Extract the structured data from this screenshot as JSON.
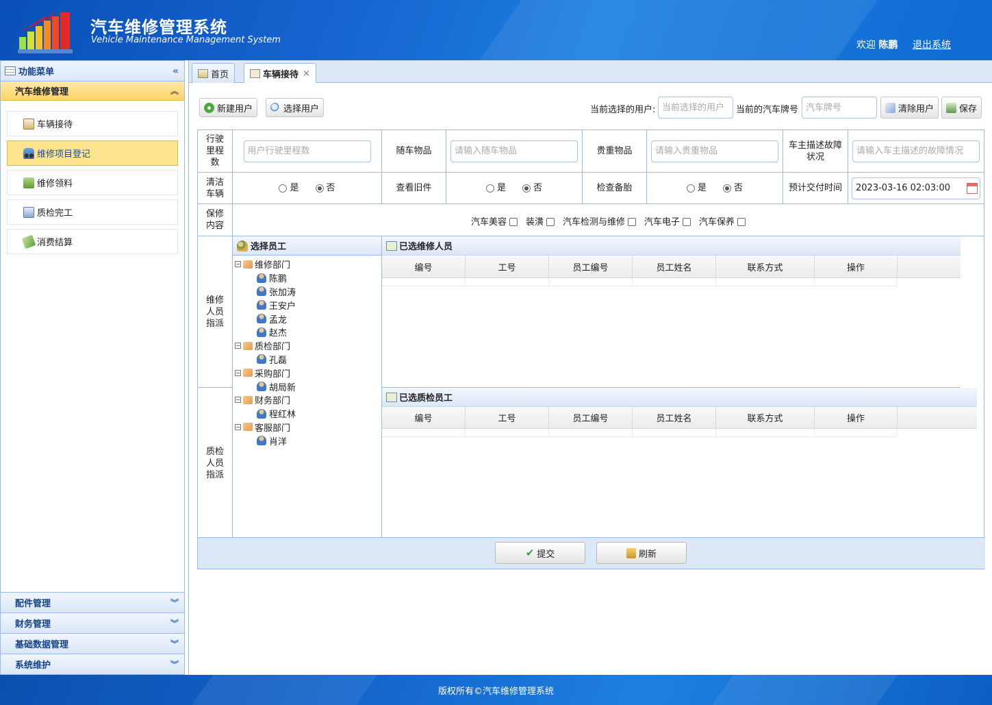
{
  "header": {
    "title_cn": "汽车维修管理系统",
    "title_en": "Vehicle Maintenance Management System",
    "welcome_prefix": "欢迎",
    "user_name": "陈鹏",
    "logout": "退出系统"
  },
  "sidebar": {
    "title": "功能菜单",
    "open_group": "汽车维修管理",
    "items": [
      {
        "label": "车辆接待",
        "icon": "reception-icon"
      },
      {
        "label": "维修项目登记",
        "icon": "car-icon",
        "active": true
      },
      {
        "label": "维修领料",
        "icon": "cart-icon"
      },
      {
        "label": "质检完工",
        "icon": "quality-icon"
      },
      {
        "label": "消费结算",
        "icon": "money-icon"
      }
    ],
    "collapsed_groups": [
      "配件管理",
      "财务管理",
      "基础数据管理",
      "系统维护"
    ]
  },
  "tabs": [
    {
      "label": "首页"
    },
    {
      "label": "车辆接待",
      "selected": true
    }
  ],
  "toolbar": {
    "new_user": "新建用户",
    "select_user": "选择用户",
    "current_user_label": "当前选择的用户:",
    "current_user_placeholder": "当前选择的用户",
    "plate_label": "当前的汽车牌号",
    "plate_placeholder": "汽车牌号",
    "clear_user": "清除用户",
    "save": "保存"
  },
  "form": {
    "mileage_label": "行驶里程数",
    "mileage_placeholder": "用户行驶里程数",
    "items_label": "随车物品",
    "items_placeholder": "请输入随车物品",
    "valuables_label": "贵重物品",
    "valuables_placeholder": "请输入贵重物品",
    "fault_label": "车主描述故障状况",
    "fault_placeholder": "请输入车主描述的故障情况",
    "clean_label": "清洁车辆",
    "old_parts_label": "查看旧件",
    "spare_tire_label": "检查备胎",
    "yes": "是",
    "no": "否",
    "delivery_label": "预计交付时间",
    "delivery_value": "2023-03-16 02:03:00",
    "maintenance_label": "保修内容",
    "maintenance_options": [
      "汽车美容",
      "装潢",
      "汽车检测与维修",
      "汽车电子",
      "汽车保养"
    ],
    "repair_assign_label": "维修人员指派",
    "qc_assign_label": "质检人员指派"
  },
  "tree": {
    "title": "选择员工",
    "departments": [
      {
        "name": "维修部门",
        "staff": [
          "陈鹏",
          "张加涛",
          "王安户",
          "孟龙",
          "赵杰"
        ]
      },
      {
        "name": "质检部门",
        "staff": [
          "孔磊"
        ]
      },
      {
        "name": "采购部门",
        "staff": [
          "胡局新"
        ]
      },
      {
        "name": "财务部门",
        "staff": [
          "程红林"
        ]
      },
      {
        "name": "客服部门",
        "staff": [
          "肖洋"
        ]
      }
    ]
  },
  "repair_grid": {
    "title": "已选维修人员",
    "columns": [
      "编号",
      "工号",
      "员工编号",
      "员工姓名",
      "联系方式",
      "操作"
    ]
  },
  "qc_grid": {
    "title": "已选质检员工",
    "columns": [
      "编号",
      "工号",
      "员工编号",
      "员工姓名",
      "联系方式",
      "操作"
    ]
  },
  "actions": {
    "submit": "提交",
    "refresh": "刷新"
  },
  "footer": {
    "copyright": "版权所有©汽车维修管理系统"
  }
}
